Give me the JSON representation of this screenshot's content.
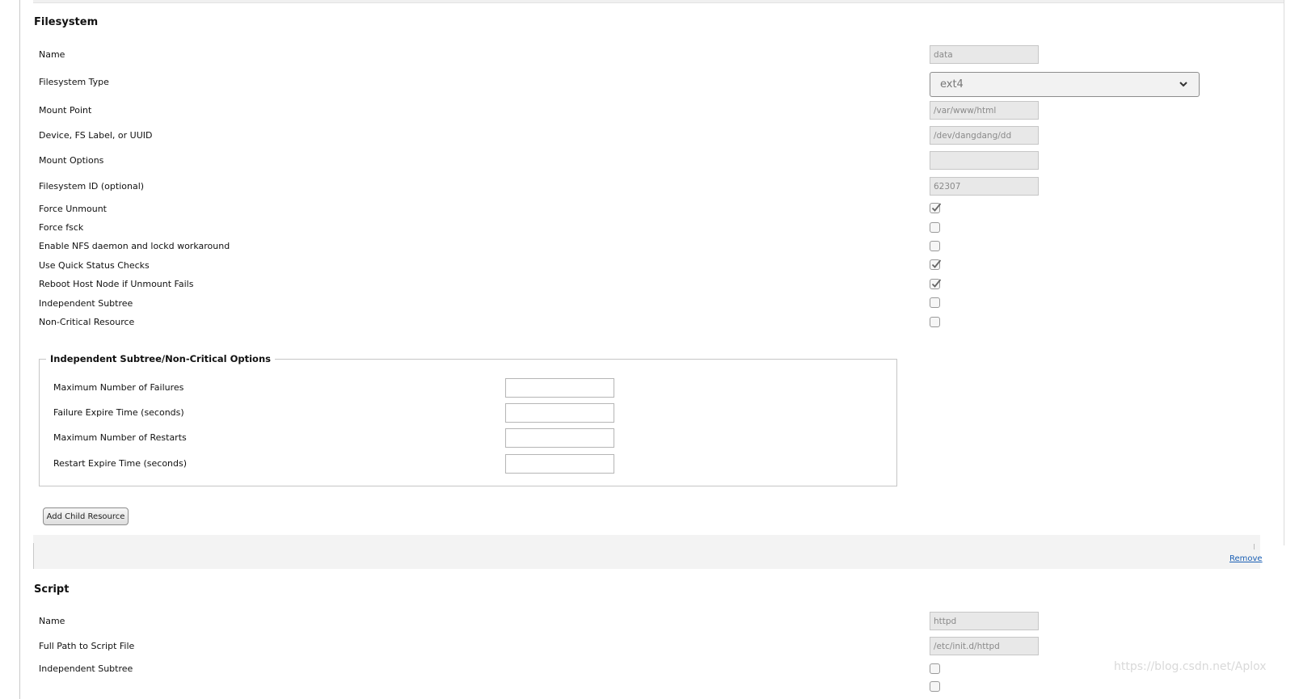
{
  "filesystem": {
    "title": "Filesystem",
    "fields": {
      "name": {
        "label": "Name",
        "value": "data"
      },
      "fs_type": {
        "label": "Filesystem Type",
        "value": "ext4"
      },
      "mount_point": {
        "label": "Mount Point",
        "value": "/var/www/html"
      },
      "device": {
        "label": "Device, FS Label, or UUID",
        "value": "/dev/dangdang/dd"
      },
      "mount_options": {
        "label": "Mount Options",
        "value": ""
      },
      "fs_id": {
        "label": "Filesystem ID (optional)",
        "value": "62307"
      }
    },
    "checkboxes": [
      {
        "label": "Force Unmount",
        "checked": true
      },
      {
        "label": "Force fsck",
        "checked": false
      },
      {
        "label": "Enable NFS daemon and lockd workaround",
        "checked": false
      },
      {
        "label": "Use Quick Status Checks",
        "checked": true
      },
      {
        "label": "Reboot Host Node if Unmount Fails",
        "checked": true
      },
      {
        "label": "Independent Subtree",
        "checked": false
      },
      {
        "label": "Non-Critical Resource",
        "checked": false
      }
    ],
    "options_group": {
      "legend": "Independent Subtree/Non-Critical Options",
      "fields": [
        {
          "label": "Maximum Number of Failures",
          "value": ""
        },
        {
          "label": "Failure Expire Time (seconds)",
          "value": ""
        },
        {
          "label": "Maximum Number of Restarts",
          "value": ""
        },
        {
          "label": "Restart Expire Time (seconds)",
          "value": ""
        }
      ]
    },
    "add_child_label": "Add Child Resource"
  },
  "separator": {
    "remove_label": "Remove"
  },
  "script": {
    "title": "Script",
    "fields": {
      "name": {
        "label": "Name",
        "value": "httpd"
      },
      "path": {
        "label": "Full Path to Script File",
        "value": "/etc/init.d/httpd"
      }
    },
    "checkboxes": [
      {
        "label": "Independent Subtree",
        "checked": false
      }
    ]
  },
  "watermark": "https://blog.csdn.net/Aplox",
  "colors": {
    "link": "#1a5fb4",
    "input_bg": "#e8e8e8",
    "band_bg": "#f3f3f3"
  }
}
